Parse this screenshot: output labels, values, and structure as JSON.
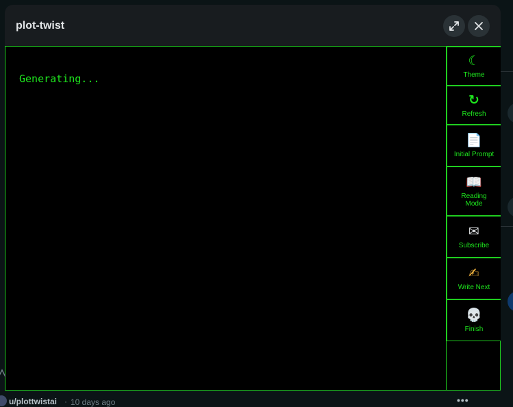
{
  "modal": {
    "title": "plot-twist",
    "expand_icon": "expand-icon",
    "close_icon": "close-icon"
  },
  "story": {
    "status_text": "Generating..."
  },
  "toolbar": {
    "items": [
      {
        "label": "Theme",
        "icon": "moon-icon",
        "glyph": "☾"
      },
      {
        "label": "Refresh",
        "icon": "refresh-icon",
        "glyph": "↻"
      },
      {
        "label": "Initial Prompt",
        "icon": "document-icon",
        "glyph": "📄"
      },
      {
        "label": "Reading Mode",
        "icon": "book-icon",
        "glyph": "📖"
      },
      {
        "label": "Subscribe",
        "icon": "envelope-icon",
        "glyph": "✉"
      },
      {
        "label": "Write Next",
        "icon": "writing-hand-icon",
        "glyph": "✍"
      },
      {
        "label": "Finish",
        "icon": "skull-icon",
        "glyph": "💀"
      }
    ]
  },
  "post": {
    "author": "u/plottwistai",
    "time": "10 days ago"
  },
  "colors": {
    "accent": "#1ee61e",
    "modal_bg": "#181c1f",
    "page_bg": "#0b1416"
  }
}
